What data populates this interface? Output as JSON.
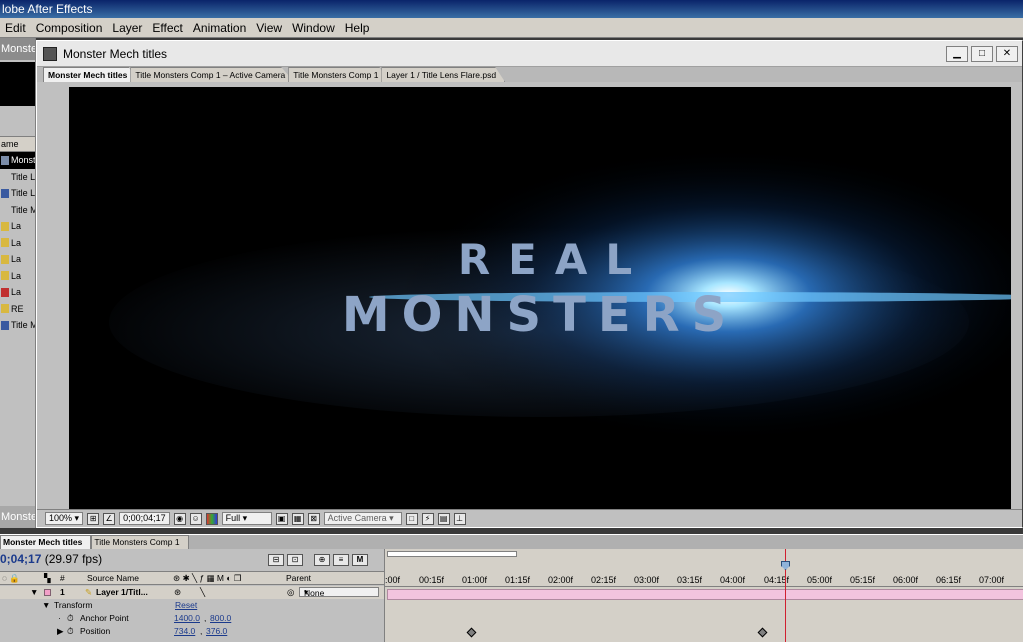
{
  "app": {
    "title": "lobe After Effects"
  },
  "menu": [
    "Edit",
    "Composition",
    "Layer",
    "Effect",
    "Animation",
    "View",
    "Window",
    "Help"
  ],
  "project": {
    "tab": "Monster",
    "column": "ame",
    "items": [
      "Monste",
      "Title Le",
      "Title Le",
      "Title M",
      "La",
      "La",
      "La",
      "La",
      "La",
      "RE",
      "Title M"
    ],
    "bottom_tab": "Monster"
  },
  "comp_window": {
    "title": "Monster Mech titles",
    "tabs": [
      "Monster Mech titles",
      "Title Monsters Comp 1 – Active Camera",
      "Title Monsters Comp 1",
      "Layer 1 / Title Lens Flare.psd"
    ],
    "title_line1": "REAL",
    "title_line2": "MONSTERS",
    "footer": {
      "zoom": "100%",
      "timecode": "0;00;04;17",
      "resolution": "Full",
      "camera": "Active Camera"
    }
  },
  "timeline": {
    "tabs": [
      "Monster Mech titles",
      "Title Monsters Comp 1"
    ],
    "timecode": "0;04;17",
    "fps": "(29.97 fps)",
    "headers": {
      "hash": "#",
      "source": "Source Name",
      "parent": "Parent"
    },
    "layer": {
      "number": "1",
      "name": "Layer 1/Titl...",
      "parent": "None"
    },
    "transform": {
      "label": "Transform",
      "reset": "Reset"
    },
    "anchor": {
      "label": "Anchor Point",
      "x": "1400.0",
      "y": "800.0"
    },
    "position": {
      "label": "Position",
      "x": "734.0",
      "y": "376.0"
    },
    "ruler": [
      ":00f",
      "00:15f",
      "01:00f",
      "01:15f",
      "02:00f",
      "02:15f",
      "03:00f",
      "03:15f",
      "04:00f",
      "04:15f",
      "05:00f",
      "05:15f",
      "06:00f",
      "06:15f",
      "07:00f"
    ]
  }
}
